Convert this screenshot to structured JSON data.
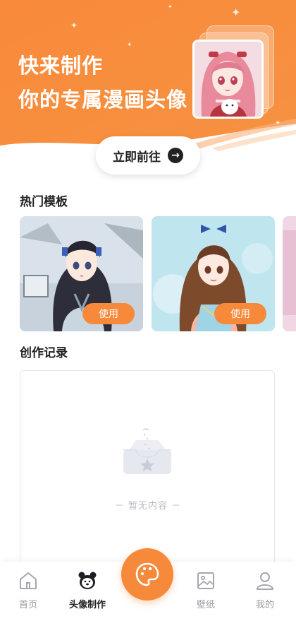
{
  "hero": {
    "line1": "快来制作",
    "line2": "你的专属漫画头像",
    "go_button": "立即前往",
    "colors": {
      "accent": "#f7893a"
    }
  },
  "sections": {
    "hot_templates": "热门模板",
    "creation_records": "创作记录"
  },
  "templates": [
    {
      "use_label": "使用",
      "icon": "template-girl-hanfu-snow"
    },
    {
      "use_label": "使用",
      "icon": "template-girl-blue-bow"
    }
  ],
  "empty": {
    "text": "－ 暂无内容 －",
    "icon": "empty-box-icon"
  },
  "tabbar": {
    "items": [
      {
        "label": "首页",
        "icon": "home-icon"
      },
      {
        "label": "头像制作",
        "icon": "bear-icon",
        "active": true
      },
      {
        "label": "",
        "icon": "palette-icon"
      },
      {
        "label": "壁纸",
        "icon": "image-icon"
      },
      {
        "label": "我的",
        "icon": "user-icon"
      }
    ]
  }
}
